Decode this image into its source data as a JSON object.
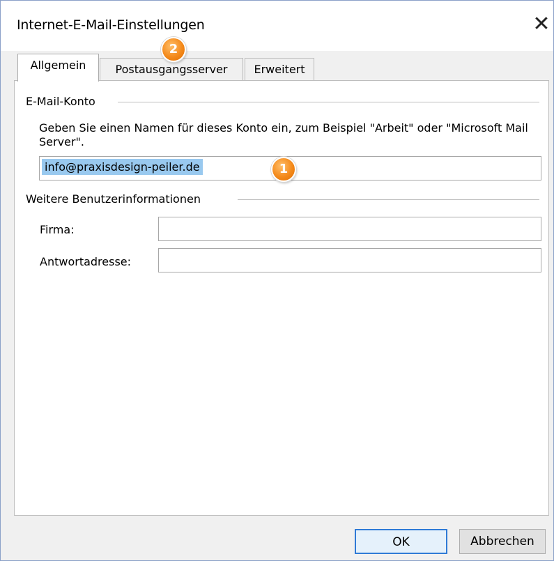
{
  "window": {
    "title": "Internet-E-Mail-Einstellungen",
    "close_symbol": "✕"
  },
  "tabs": [
    {
      "label": "Allgemein",
      "active": true
    },
    {
      "label": "Postausgangsserver",
      "active": false
    },
    {
      "label": "Erweitert",
      "active": false
    }
  ],
  "account_group": {
    "label": "E-Mail-Konto",
    "description": "Geben Sie einen Namen für dieses Konto ein, zum Beispiel \"Arbeit\" oder \"Microsoft Mail Server\".",
    "account_name_value": "info@praxisdesign-peiler.de"
  },
  "user_info_group": {
    "label": "Weitere Benutzerinformationen",
    "company_label": "Firma:",
    "company_value": "",
    "reply_label": "Antwortadresse:",
    "reply_value": ""
  },
  "annotations": {
    "badge_1": "1",
    "badge_2": "2",
    "badge_color": "#f48a1b"
  },
  "buttons": {
    "ok_label": "OK",
    "cancel_label": "Abbrechen"
  },
  "icons": {
    "close": "close-icon"
  }
}
